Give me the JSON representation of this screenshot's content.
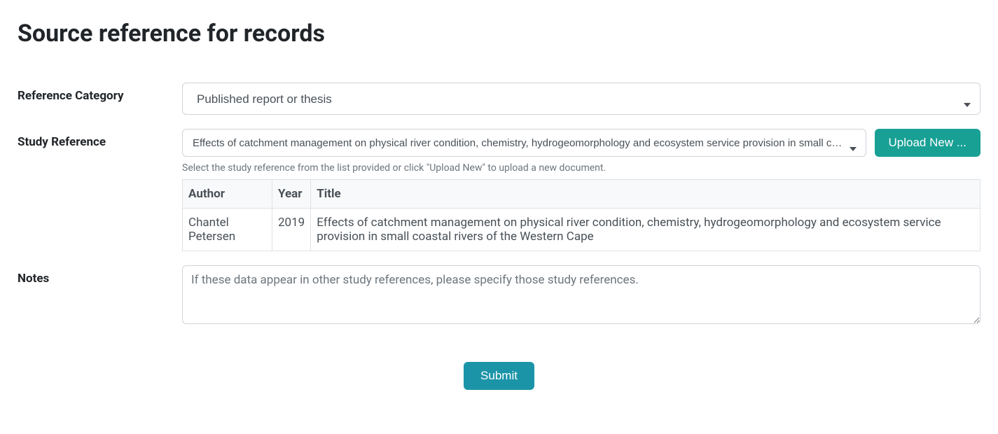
{
  "page": {
    "title": "Source reference for records"
  },
  "form": {
    "reference_category": {
      "label": "Reference Category",
      "selected": "Published report or thesis"
    },
    "study_reference": {
      "label": "Study Reference",
      "selected": "Effects of catchment management on physical river condition, chemistry, hydrogeomorphology and ecosystem service provision in small coastal rivers of the Western Cape",
      "upload_button": "Upload New ...",
      "help_text": "Select the study reference from the list provided or click \"Upload New\" to upload a new document."
    },
    "reference_table": {
      "headers": {
        "author": "Author",
        "year": "Year",
        "title": "Title"
      },
      "rows": [
        {
          "author": "Chantel Petersen",
          "year": "2019",
          "title": "Effects of catchment management on physical river condition, chemistry, hydrogeomorphology and ecosystem service provision in small coastal rivers of the Western Cape"
        }
      ]
    },
    "notes": {
      "label": "Notes",
      "placeholder": "If these data appear in other study references, please specify those study references."
    },
    "submit_label": "Submit"
  }
}
